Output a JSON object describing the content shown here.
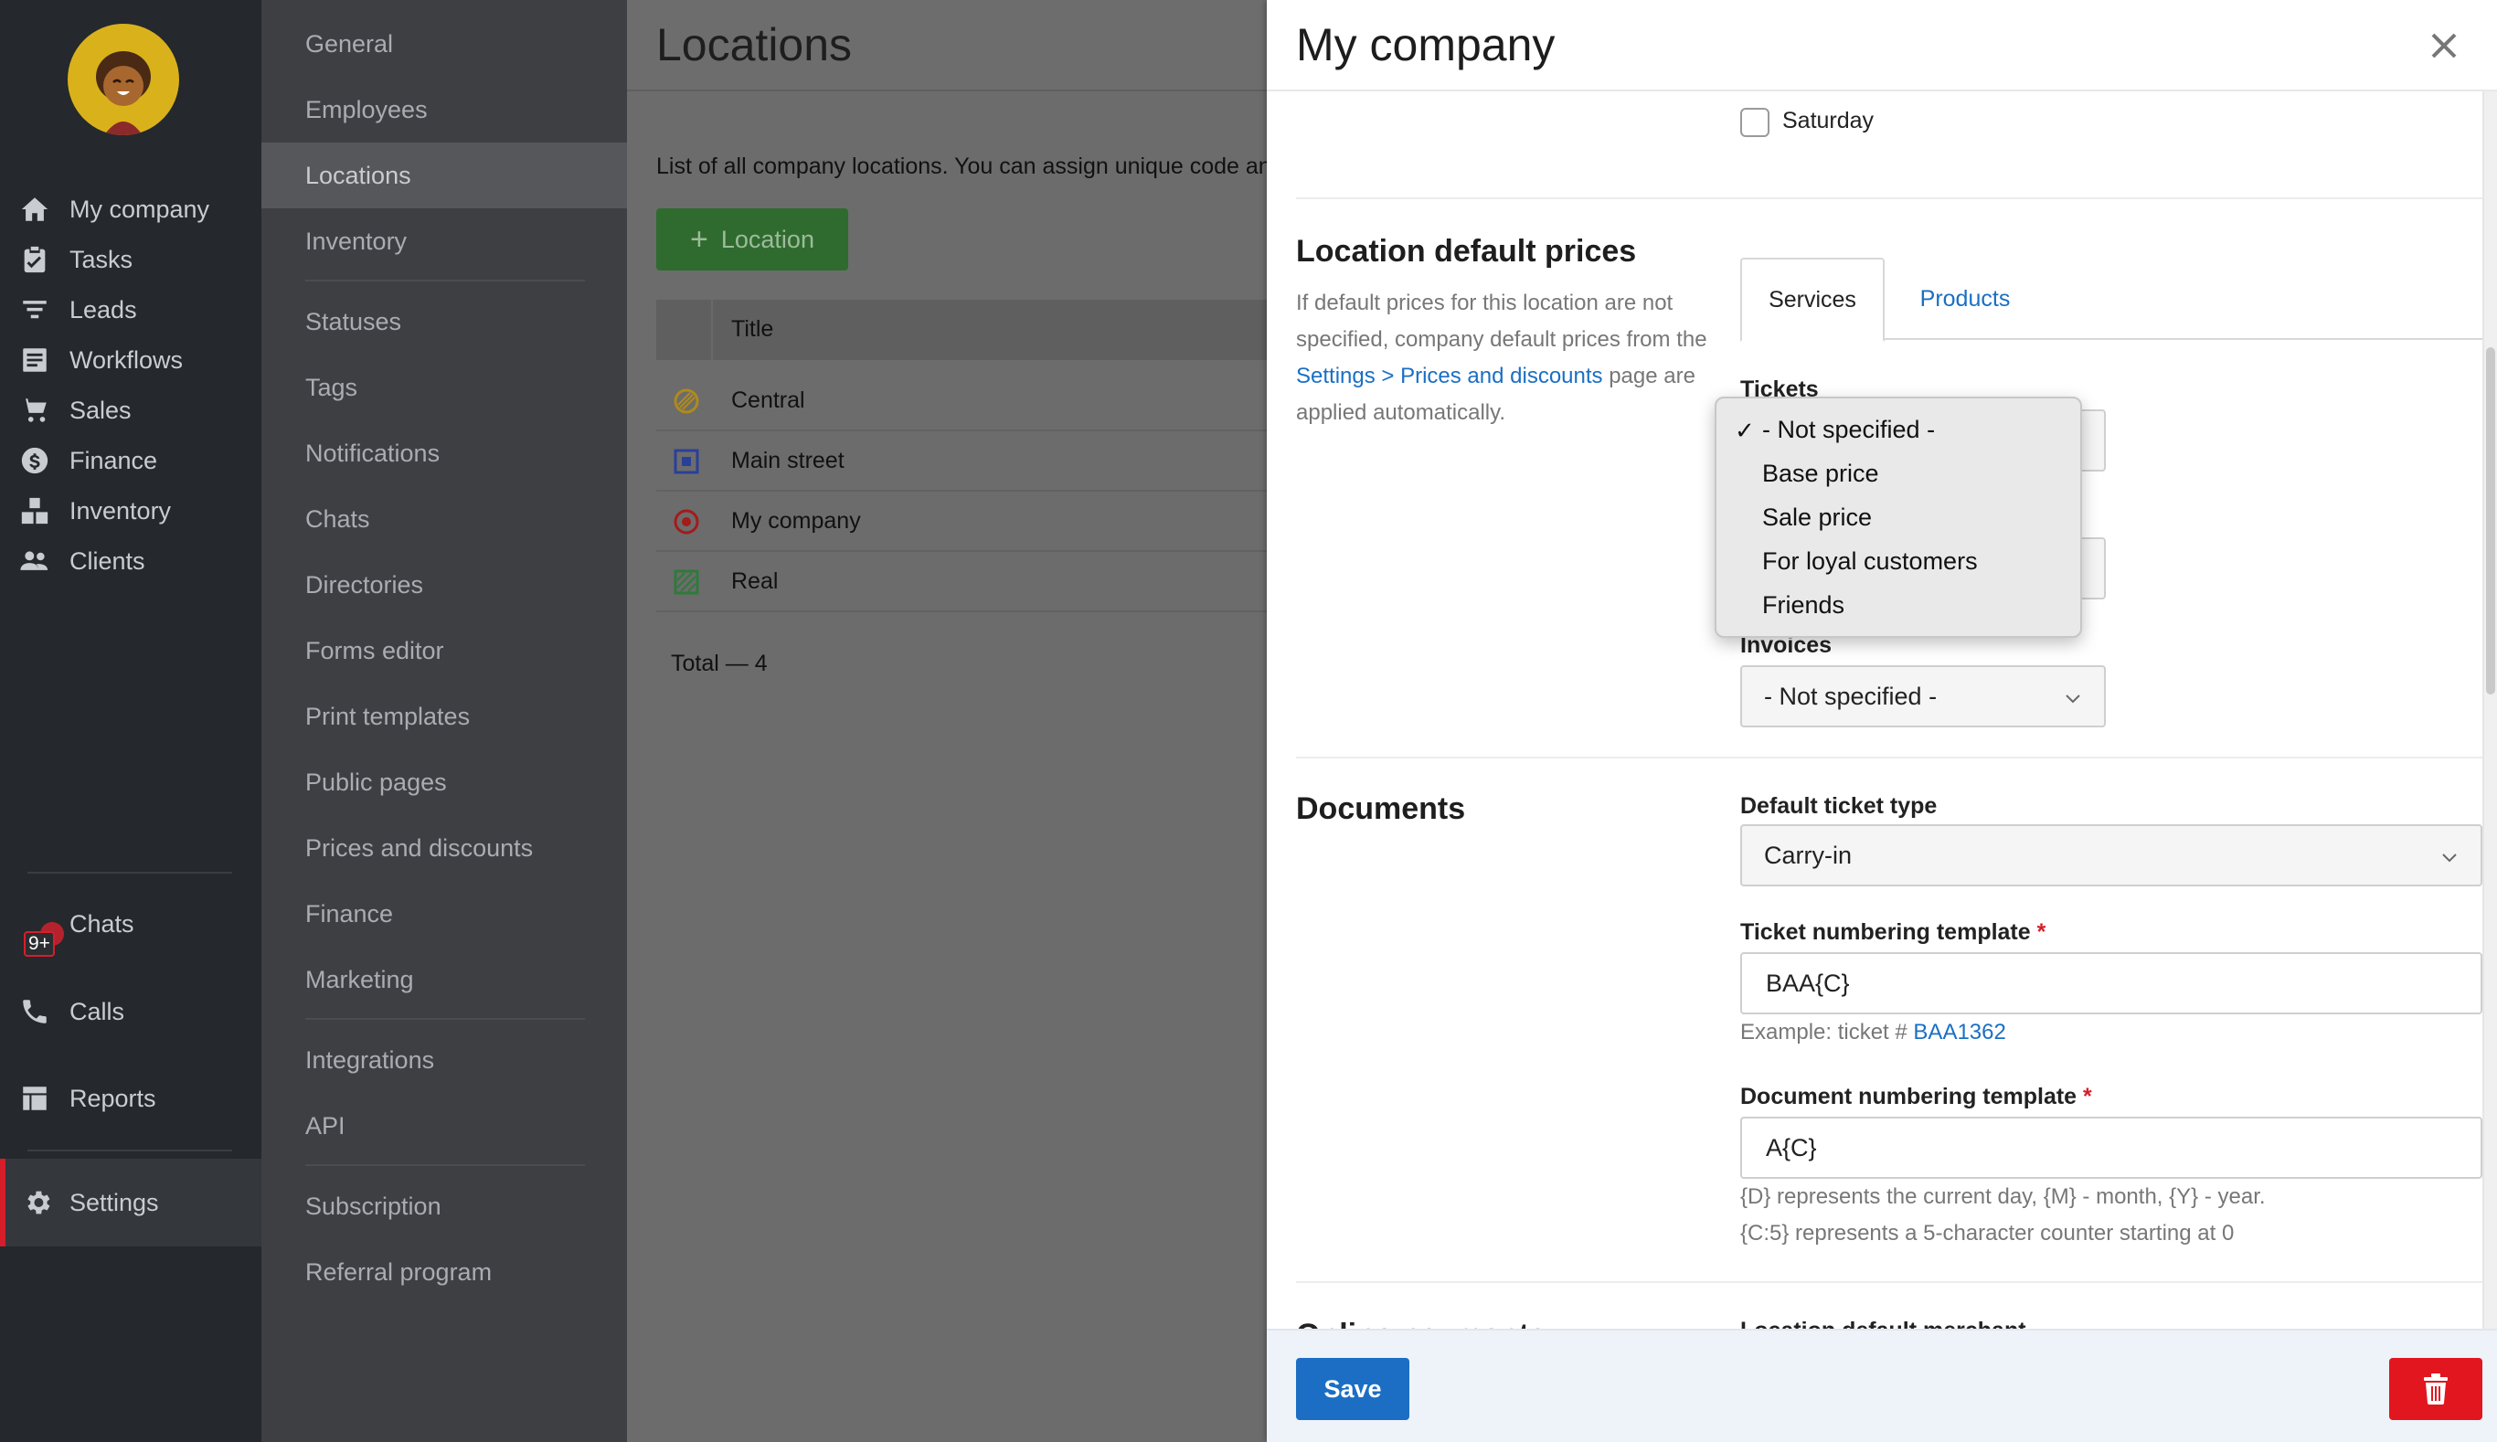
{
  "nav": {
    "items": [
      {
        "label": "My company",
        "icon": "home-icon"
      },
      {
        "label": "Tasks",
        "icon": "clipboard-icon"
      },
      {
        "label": "Leads",
        "icon": "filter-icon"
      },
      {
        "label": "Workflows",
        "icon": "inbox-icon"
      },
      {
        "label": "Sales",
        "icon": "cart-icon"
      },
      {
        "label": "Finance",
        "icon": "dollar-icon"
      },
      {
        "label": "Inventory",
        "icon": "boxes-icon"
      },
      {
        "label": "Clients",
        "icon": "users-icon"
      },
      {
        "label": "Chats",
        "icon": "chat-icon",
        "badge": "9+"
      },
      {
        "label": "Calls",
        "icon": "phone-icon"
      },
      {
        "label": "Reports",
        "icon": "table-icon"
      },
      {
        "label": "Settings",
        "icon": "gear-icon",
        "active": true
      }
    ]
  },
  "settings_menu": {
    "items": [
      "General",
      "Employees",
      "Locations",
      "Inventory",
      "Statuses",
      "Tags",
      "Notifications",
      "Chats",
      "Directories",
      "Forms editor",
      "Print templates",
      "Public pages",
      "Prices and discounts",
      "Finance",
      "Marketing",
      "Integrations",
      "API",
      "Subscription",
      "Referral program"
    ],
    "active": "Locations"
  },
  "locations_page": {
    "title": "Locations",
    "description": "List of all company locations. You can assign unique code an",
    "add_button": "Location",
    "column_title": "Title",
    "rows": [
      {
        "title": "Central",
        "icon": "striped-circle-icon",
        "color": "#b08a1a"
      },
      {
        "title": "Main street",
        "icon": "square-dot-icon",
        "color": "#2a3f9a"
      },
      {
        "title": "My company",
        "icon": "target-icon",
        "color": "#a51a1a"
      },
      {
        "title": "Real",
        "icon": "striped-square-icon",
        "color": "#2f7a3a"
      }
    ],
    "total": "Total — 4"
  },
  "panel": {
    "title": "My company",
    "saturday_label": "Saturday",
    "default_prices": {
      "title": "Location default prices",
      "desc_1": "If default prices for this location are not specified, company default prices from the ",
      "link_settings": "Settings",
      "desc_sep": " > ",
      "link_prices": "Prices and discounts",
      "desc_2": " page are applied automatically.",
      "tabs": [
        "Services",
        "Products"
      ],
      "tickets_label": "Tickets",
      "invoices_label": "Invoices",
      "invoices_value": "- Not specified -",
      "dropdown_options": [
        "- Not specified -",
        "Base price",
        "Sale price",
        "For loyal customers",
        "Friends"
      ]
    },
    "documents": {
      "title": "Documents",
      "ticket_type_label": "Default ticket type",
      "ticket_type_value": "Carry-in",
      "ticket_num_label": "Ticket numbering template",
      "ticket_num_value": "BAA{C}",
      "ticket_example_prefix": "Example: ticket # ",
      "ticket_example_value": "BAA1362",
      "doc_num_label": "Document numbering template",
      "doc_num_value": "A{C}",
      "hint_1": "{D} represents the current day, {M} - month, {Y} - year.",
      "hint_2": "{C:5} represents a 5-character counter starting at 0"
    },
    "cut_section_title": "Online payments",
    "cut_field_label": "Location default merchant",
    "save_label": "Save"
  },
  "colors": {
    "accent": "#1b6ec4",
    "danger": "#e2161f",
    "success": "#2f6b2e"
  }
}
